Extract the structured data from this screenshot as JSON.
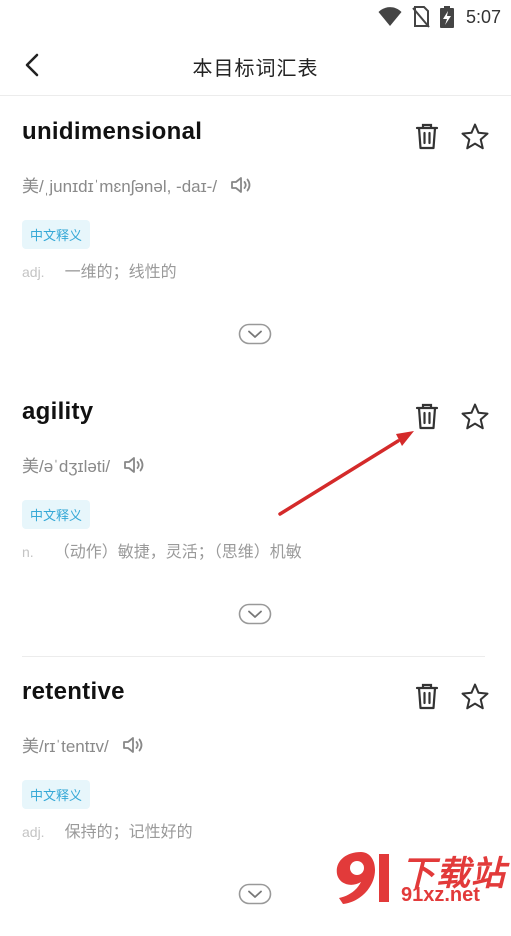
{
  "status": {
    "time": "5:07"
  },
  "header": {
    "title": "本目标词汇表"
  },
  "words": [
    {
      "word": "unidimensional",
      "pron": "美/ˌjunɪdɪˈmɛnʃənəl, -daɪ-/",
      "tag": "中文释义",
      "pos": "adj.",
      "def": "一维的；线性的"
    },
    {
      "word": "agility",
      "pron": "美/əˈdʒɪləti/",
      "tag": "中文释义",
      "pos": "n.",
      "def": "（动作）敏捷，灵活；（思维）机敏"
    },
    {
      "word": "retentive",
      "pron": "美/rɪˈtentɪv/",
      "tag": "中文释义",
      "pos": "adj.",
      "def": "保持的；记性好的"
    }
  ],
  "watermark": {
    "name": "下载站",
    "url": "91xz.net"
  },
  "colors": {
    "accent": "#35a8d6",
    "tag_bg": "#e7f6fb",
    "arrow": "#d42a2a",
    "watermark": "#e23a3a"
  },
  "icons": [
    "wifi-icon",
    "no-sim-icon",
    "battery-charging-icon",
    "back-icon",
    "trash-icon",
    "star-icon",
    "speaker-icon",
    "chevron-down-icon"
  ]
}
